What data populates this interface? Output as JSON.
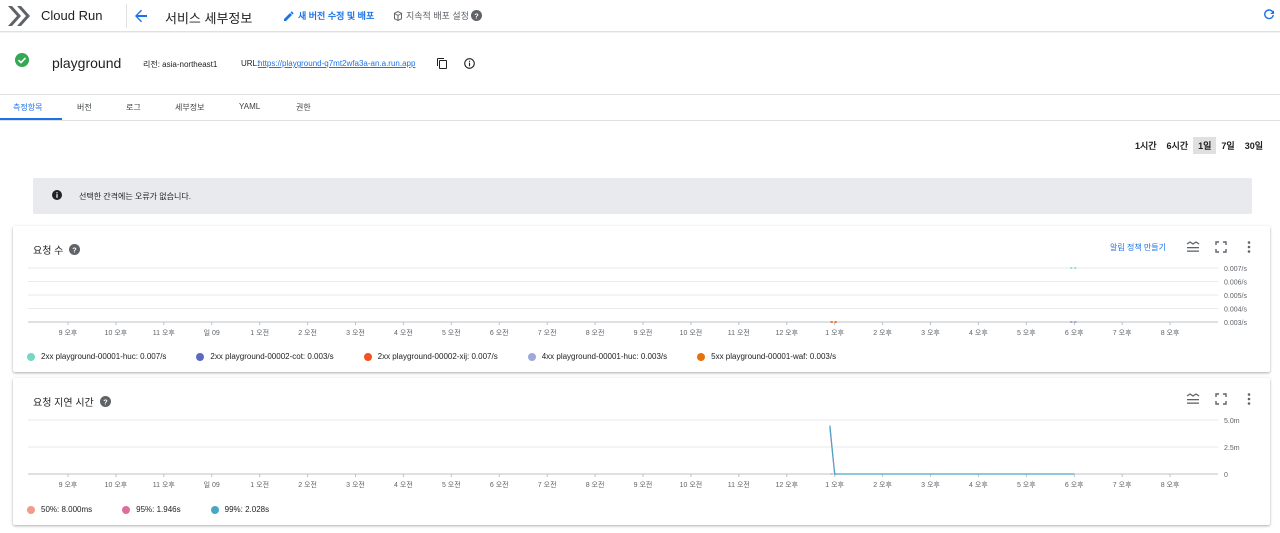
{
  "header": {
    "product": "Cloud Run",
    "page_title": "서비스 세부정보",
    "edit_label": "새 버전 수정 및 배포",
    "cd_label": "지속적 배포 설정"
  },
  "service": {
    "name": "playground",
    "region": "리전: asia-northeast1",
    "url_label": "URL:",
    "url": "https://playground-q7mt2wfa3a-an.a.run.app"
  },
  "tabs": [
    {
      "label": "측정항목",
      "active": true
    },
    {
      "label": "버전"
    },
    {
      "label": "로그"
    },
    {
      "label": "세부정보"
    },
    {
      "label": "YAML"
    },
    {
      "label": "권한"
    }
  ],
  "time_range": [
    "1시간",
    "6시간",
    "1일",
    "7일",
    "30일"
  ],
  "time_range_selected": "1일",
  "notice": "선택한 간격에는 오류가 없습니다.",
  "x_ticks": [
    "9 오후",
    "10 오후",
    "11 오후",
    "일 09",
    "1 오전",
    "2 오전",
    "3 오전",
    "4 오전",
    "5 오전",
    "6 오전",
    "7 오전",
    "8 오전",
    "9 오전",
    "10 오전",
    "11 오전",
    "12 오후",
    "1 오후",
    "2 오후",
    "3 오후",
    "4 오후",
    "5 오후",
    "6 오후",
    "7 오후",
    "8 오후"
  ],
  "card_requests": {
    "title": "요청 수",
    "alert_label": "알림 정책 만들기",
    "legend": [
      {
        "label": "2xx playground-00001-huc:",
        "value": "0.007/s",
        "color": "#76d7c4"
      },
      {
        "label": "2xx playground-00002-cot:",
        "value": "0.003/s",
        "color": "#5c6bc0"
      },
      {
        "label": "2xx playground-00002-xij:",
        "value": "0.007/s",
        "color": "#f4511e"
      },
      {
        "label": "4xx playground-00001-huc:",
        "value": "0.003/s",
        "color": "#9fa8da"
      },
      {
        "label": "5xx playground-00001-waf:",
        "value": "0.003/s",
        "color": "#e8710a"
      }
    ]
  },
  "card_latency": {
    "title": "요청 지연 시간",
    "legend": [
      {
        "label": "50%:",
        "value": "8.000ms",
        "color": "#f19b8a"
      },
      {
        "label": "95%:",
        "value": "1.946s",
        "color": "#e06c9f"
      },
      {
        "label": "99%:",
        "value": "2.028s",
        "color": "#4aa6c7"
      }
    ]
  },
  "chart_data": [
    {
      "type": "line",
      "title": "요청 수",
      "xlabel": "",
      "ylabel": "",
      "y_ticks": [
        "0.007/s",
        "0.006/s",
        "0.005/s",
        "0.004/s",
        "0.003/s"
      ],
      "ylim": [
        0.003,
        0.007
      ],
      "x": [
        "9 오후",
        "10 오후",
        "11 오후",
        "일 09",
        "1 오전",
        "2 오전",
        "3 오전",
        "4 오전",
        "5 오전",
        "6 오전",
        "7 오전",
        "8 오전",
        "9 오전",
        "10 오전",
        "11 오전",
        "12 오후",
        "1 오후",
        "2 오후",
        "3 오후",
        "4 오후",
        "5 오후",
        "6 오후",
        "7 오후",
        "8 오후"
      ],
      "series": [
        {
          "name": "2xx playground-00001-huc",
          "points": [
            [
              21.0,
              0.007
            ]
          ]
        },
        {
          "name": "2xx playground-00002-cot",
          "points": [
            [
              21.0,
              0.003
            ]
          ]
        },
        {
          "name": "2xx playground-00002-xij",
          "points": [
            [
              16.0,
              0.003
            ]
          ]
        },
        {
          "name": "4xx playground-00001-huc",
          "points": [
            [
              21.0,
              0.003
            ]
          ]
        },
        {
          "name": "5xx playground-00001-waf",
          "points": [
            [
              16.0,
              0.003
            ]
          ]
        }
      ]
    },
    {
      "type": "line",
      "title": "요청 지연 시간",
      "xlabel": "",
      "ylabel": "",
      "y_ticks": [
        "5.0m",
        "2.5m",
        "0"
      ],
      "ylim": [
        0,
        5.0
      ],
      "x": [
        "9 오후",
        "10 오후",
        "11 오후",
        "일 09",
        "1 오전",
        "2 오전",
        "3 오전",
        "4 오전",
        "5 오전",
        "6 오전",
        "7 오전",
        "8 오전",
        "9 오전",
        "10 오전",
        "11 오전",
        "12 오후",
        "1 오후",
        "2 오후",
        "3 오후",
        "4 오후",
        "5 오후",
        "6 오후",
        "7 오후",
        "8 오후"
      ],
      "series": [
        {
          "name": "50%",
          "points": [
            [
              16.0,
              0.0
            ]
          ]
        },
        {
          "name": "95%",
          "points": [
            [
              15.9,
              4.3
            ],
            [
              16.0,
              0.0
            ]
          ]
        },
        {
          "name": "99%",
          "points": [
            [
              15.9,
              4.5
            ],
            [
              16.0,
              0.0
            ],
            [
              21.0,
              0.0
            ]
          ]
        }
      ]
    }
  ]
}
